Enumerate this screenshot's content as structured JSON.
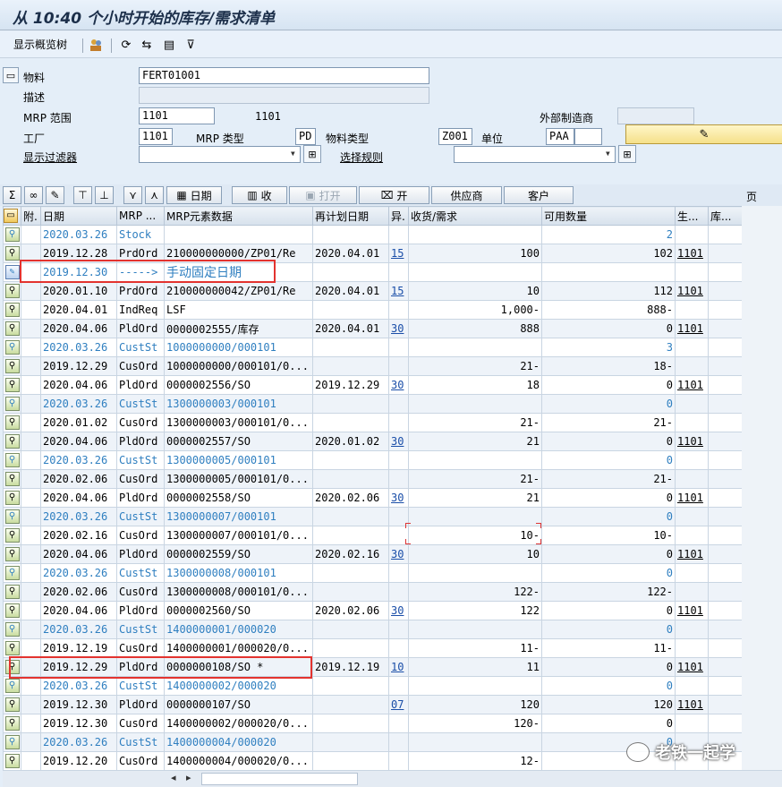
{
  "window": {
    "title": "从 10:40 个小时开始的库存/需求清单"
  },
  "toolbar": {
    "overview_tree": "显示概览树"
  },
  "header": {
    "material_label": "物料",
    "material_value": "FERT01001",
    "description_label": "描述",
    "mrp_area_label": "MRP 范围",
    "mrp_area_value": "1101",
    "mrp_area_text": "1101",
    "external_procurement_label": "外部制造商",
    "plant_label": "工厂",
    "plant_value": "1101",
    "mrp_type_label": "MRP 类型",
    "mrp_type_value": "PD",
    "material_type_label": "物料类型",
    "material_type_value": "Z001",
    "unit_label": "单位",
    "unit_value": "PAA",
    "display_filter_label": "显示过滤器",
    "selection_rule_label": "选择规则"
  },
  "grid_toolbar": {
    "date_btn": "日期",
    "receipts_btn": "收",
    "open_btn": "打开",
    "open2_btn": "开",
    "vendor_btn": "供应商",
    "customer_btn": "客户",
    "page_label": "页"
  },
  "columns": [
    "附.",
    "日期",
    "MRP ...",
    "MRP元素数据",
    "再计划日期",
    "异.",
    "收货/需求",
    "可用数量",
    "生...",
    "库..."
  ],
  "rows": [
    {
      "date": "2020.03.26",
      "mrp": "Stock",
      "data": "",
      "resched": "",
      "exc": "",
      "qty": "",
      "avail": "2",
      "plant": "",
      "blue": true
    },
    {
      "date": "2019.12.28",
      "mrp": "PrdOrd",
      "data": "210000000000/ZP01/Re",
      "resched": "2020.04.01",
      "exc": "15",
      "qty": "100",
      "avail": "102",
      "plant": "1101",
      "blue": false
    },
    {
      "date": "2019.12.30",
      "mrp": "----->",
      "data": "手动固定日期",
      "resched": "",
      "exc": "",
      "qty": "",
      "avail": "",
      "plant": "",
      "blue": true,
      "manual": true
    },
    {
      "date": "2020.01.10",
      "mrp": "PrdOrd",
      "data": "210000000042/ZP01/Re",
      "resched": "2020.04.01",
      "exc": "15",
      "qty": "10",
      "avail": "112",
      "plant": "1101",
      "blue": false
    },
    {
      "date": "2020.04.01",
      "mrp": "IndReq",
      "data": "LSF",
      "resched": "",
      "exc": "",
      "qty": "1,000-",
      "avail": "888-",
      "plant": "",
      "blue": false
    },
    {
      "date": "2020.04.06",
      "mrp": "PldOrd",
      "data": "0000002555/库存",
      "resched": "2020.04.01",
      "exc": "30",
      "qty": "888",
      "avail": "0",
      "plant": "1101",
      "blue": false
    },
    {
      "date": "2020.03.26",
      "mrp": "CustSt",
      "data": "1000000000/000101",
      "resched": "",
      "exc": "",
      "qty": "",
      "avail": "3",
      "plant": "",
      "blue": true
    },
    {
      "date": "2019.12.29",
      "mrp": "CusOrd",
      "data": "1000000000/000101/0...",
      "resched": "",
      "exc": "",
      "qty": "21-",
      "avail": "18-",
      "plant": "",
      "blue": false
    },
    {
      "date": "2020.04.06",
      "mrp": "PldOrd",
      "data": "0000002556/SO",
      "resched": "2019.12.29",
      "exc": "30",
      "qty": "18",
      "avail": "0",
      "plant": "1101",
      "blue": false
    },
    {
      "date": "2020.03.26",
      "mrp": "CustSt",
      "data": "1300000003/000101",
      "resched": "",
      "exc": "",
      "qty": "",
      "avail": "0",
      "plant": "",
      "blue": true
    },
    {
      "date": "2020.01.02",
      "mrp": "CusOrd",
      "data": "1300000003/000101/0...",
      "resched": "",
      "exc": "",
      "qty": "21-",
      "avail": "21-",
      "plant": "",
      "blue": false
    },
    {
      "date": "2020.04.06",
      "mrp": "PldOrd",
      "data": "0000002557/SO",
      "resched": "2020.01.02",
      "exc": "30",
      "qty": "21",
      "avail": "0",
      "plant": "1101",
      "blue": false
    },
    {
      "date": "2020.03.26",
      "mrp": "CustSt",
      "data": "1300000005/000101",
      "resched": "",
      "exc": "",
      "qty": "",
      "avail": "0",
      "plant": "",
      "blue": true
    },
    {
      "date": "2020.02.06",
      "mrp": "CusOrd",
      "data": "1300000005/000101/0...",
      "resched": "",
      "exc": "",
      "qty": "21-",
      "avail": "21-",
      "plant": "",
      "blue": false
    },
    {
      "date": "2020.04.06",
      "mrp": "PldOrd",
      "data": "0000002558/SO",
      "resched": "2020.02.06",
      "exc": "30",
      "qty": "21",
      "avail": "0",
      "plant": "1101",
      "blue": false
    },
    {
      "date": "2020.03.26",
      "mrp": "CustSt",
      "data": "1300000007/000101",
      "resched": "",
      "exc": "",
      "qty": "",
      "avail": "0",
      "plant": "",
      "blue": true
    },
    {
      "date": "2020.02.16",
      "mrp": "CusOrd",
      "data": "1300000007/000101/0...",
      "resched": "",
      "exc": "",
      "qty": "10-",
      "avail": "10-",
      "plant": "",
      "blue": false
    },
    {
      "date": "2020.04.06",
      "mrp": "PldOrd",
      "data": "0000002559/SO",
      "resched": "2020.02.16",
      "exc": "30",
      "qty": "10",
      "avail": "0",
      "plant": "1101",
      "blue": false
    },
    {
      "date": "2020.03.26",
      "mrp": "CustSt",
      "data": "1300000008/000101",
      "resched": "",
      "exc": "",
      "qty": "",
      "avail": "0",
      "plant": "",
      "blue": true
    },
    {
      "date": "2020.02.06",
      "mrp": "CusOrd",
      "data": "1300000008/000101/0...",
      "resched": "",
      "exc": "",
      "qty": "122-",
      "avail": "122-",
      "plant": "",
      "blue": false
    },
    {
      "date": "2020.04.06",
      "mrp": "PldOrd",
      "data": "0000002560/SO",
      "resched": "2020.02.06",
      "exc": "30",
      "qty": "122",
      "avail": "0",
      "plant": "1101",
      "blue": false
    },
    {
      "date": "2020.03.26",
      "mrp": "CustSt",
      "data": "1400000001/000020",
      "resched": "",
      "exc": "",
      "qty": "",
      "avail": "0",
      "plant": "",
      "blue": true
    },
    {
      "date": "2019.12.19",
      "mrp": "CusOrd",
      "data": "1400000001/000020/0...",
      "resched": "",
      "exc": "",
      "qty": "11-",
      "avail": "11-",
      "plant": "",
      "blue": false
    },
    {
      "date": "2019.12.29",
      "mrp": "PldOrd",
      "data": "0000000108/SO  *",
      "resched": "2019.12.19",
      "exc": "10",
      "qty": "11",
      "avail": "0",
      "plant": "1101",
      "blue": false
    },
    {
      "date": "2020.03.26",
      "mrp": "CustSt",
      "data": "1400000002/000020",
      "resched": "",
      "exc": "",
      "qty": "",
      "avail": "0",
      "plant": "",
      "blue": true
    },
    {
      "date": "2019.12.30",
      "mrp": "PldOrd",
      "data": "0000000107/SO",
      "resched": "",
      "exc": "07",
      "qty": "120",
      "avail": "120",
      "plant": "1101",
      "blue": false
    },
    {
      "date": "2019.12.30",
      "mrp": "CusOrd",
      "data": "1400000002/000020/0...",
      "resched": "",
      "exc": "",
      "qty": "120-",
      "avail": "0",
      "plant": "",
      "blue": false
    },
    {
      "date": "2020.03.26",
      "mrp": "CustSt",
      "data": "1400000004/000020",
      "resched": "",
      "exc": "",
      "qty": "",
      "avail": "0",
      "plant": "",
      "blue": true
    },
    {
      "date": "2019.12.20",
      "mrp": "CusOrd",
      "data": "1400000004/000020/0...",
      "resched": "",
      "exc": "",
      "qty": "12-",
      "avail": "",
      "plant": "",
      "blue": false
    }
  ],
  "watermark": "老铁一起学"
}
